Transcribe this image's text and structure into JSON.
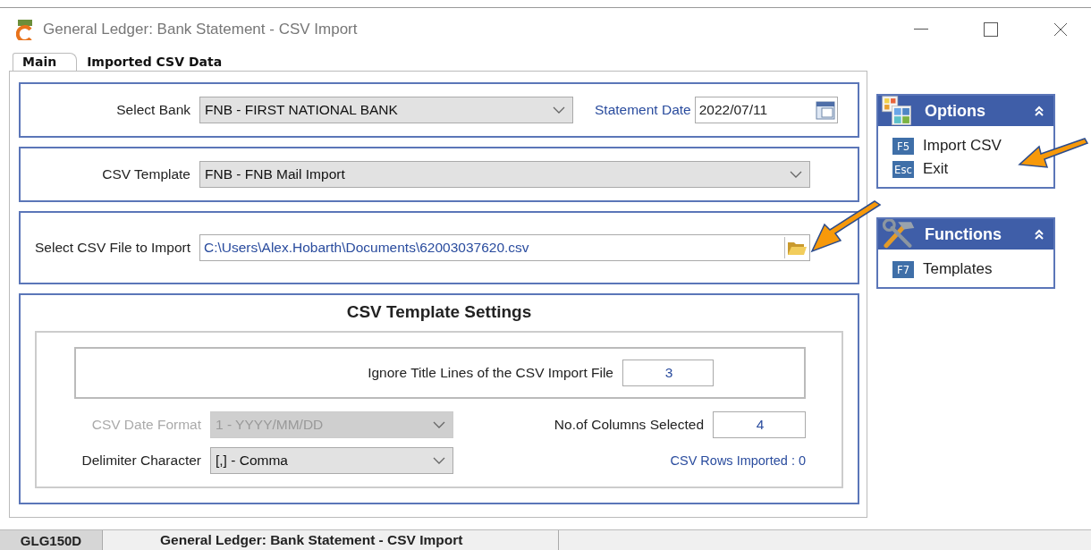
{
  "window": {
    "title": "General Ledger: Bank Statement - CSV Import"
  },
  "tabs": [
    {
      "label": "Main",
      "selected": true
    },
    {
      "label": "Imported CSV Data",
      "selected": false
    }
  ],
  "bank": {
    "label": "Select Bank",
    "value": "FNB - FIRST NATIONAL BANK"
  },
  "statement_date": {
    "label": "Statement Date",
    "value": "2022/07/11"
  },
  "csv_template": {
    "label": "CSV Template",
    "value": "FNB - FNB Mail Import"
  },
  "csv_file": {
    "label": "Select CSV File to Import",
    "value": "C:\\Users\\Alex.Hobarth\\Documents\\62003037620.csv"
  },
  "settings": {
    "title": "CSV Template Settings",
    "ignore_title_lines": {
      "label": "Ignore Title Lines of the CSV Import File",
      "value": "3"
    },
    "date_format": {
      "label": "CSV Date Format",
      "value": "1 - YYYY/MM/DD",
      "disabled": true
    },
    "columns_selected": {
      "label": "No.of Columns Selected",
      "value": "4"
    },
    "delimiter": {
      "label": "Delimiter Character",
      "value": "[,] - Comma",
      "disabled": false
    },
    "rows_imported": "CSV Rows Imported : 0"
  },
  "panels": [
    {
      "title": "Options",
      "kind": "options",
      "expanded": true,
      "items": [
        {
          "key": "F5",
          "label": "Import CSV"
        },
        {
          "key": "Esc",
          "label": "Exit"
        }
      ]
    },
    {
      "title": "Functions",
      "kind": "functions",
      "expanded": true,
      "items": [
        {
          "key": "F7",
          "label": "Templates"
        }
      ]
    }
  ],
  "status_bar": {
    "code": "GLG150D",
    "title": "General Ledger: Bank Statement - CSV Import"
  }
}
